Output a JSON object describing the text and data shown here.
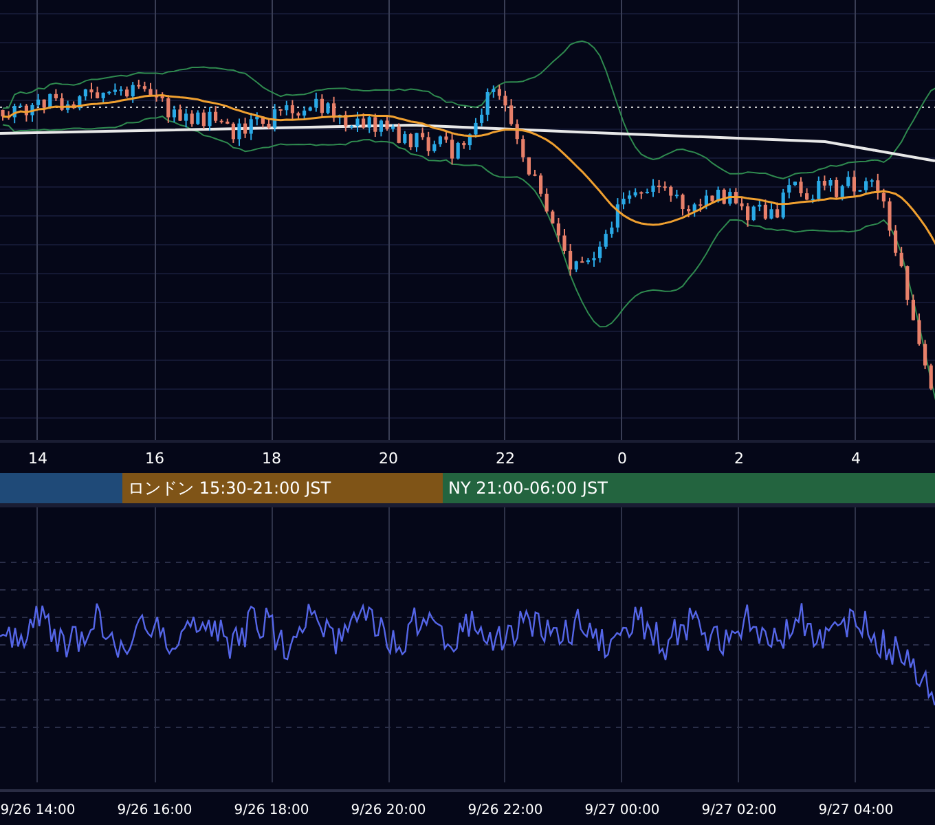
{
  "price_panel": {
    "time_axis": [
      "14",
      "16",
      "18",
      "20",
      "22",
      "0",
      "2",
      "4"
    ]
  },
  "sessions": [
    {
      "color": "#1f4a78"
    },
    {
      "label": "ロンドン 15:30-21:00 JST",
      "color": "#7f5417"
    },
    {
      "label": "NY 21:00-06:00 JST",
      "color": "#23643f"
    }
  ],
  "oscillator_panel": {
    "time_axis": [
      "9/26 14:00",
      "9/26 16:00",
      "9/26 18:00",
      "9/26 20:00",
      "9/26 22:00",
      "9/27 00:00",
      "9/27 02:00",
      "9/27 04:00"
    ]
  }
}
